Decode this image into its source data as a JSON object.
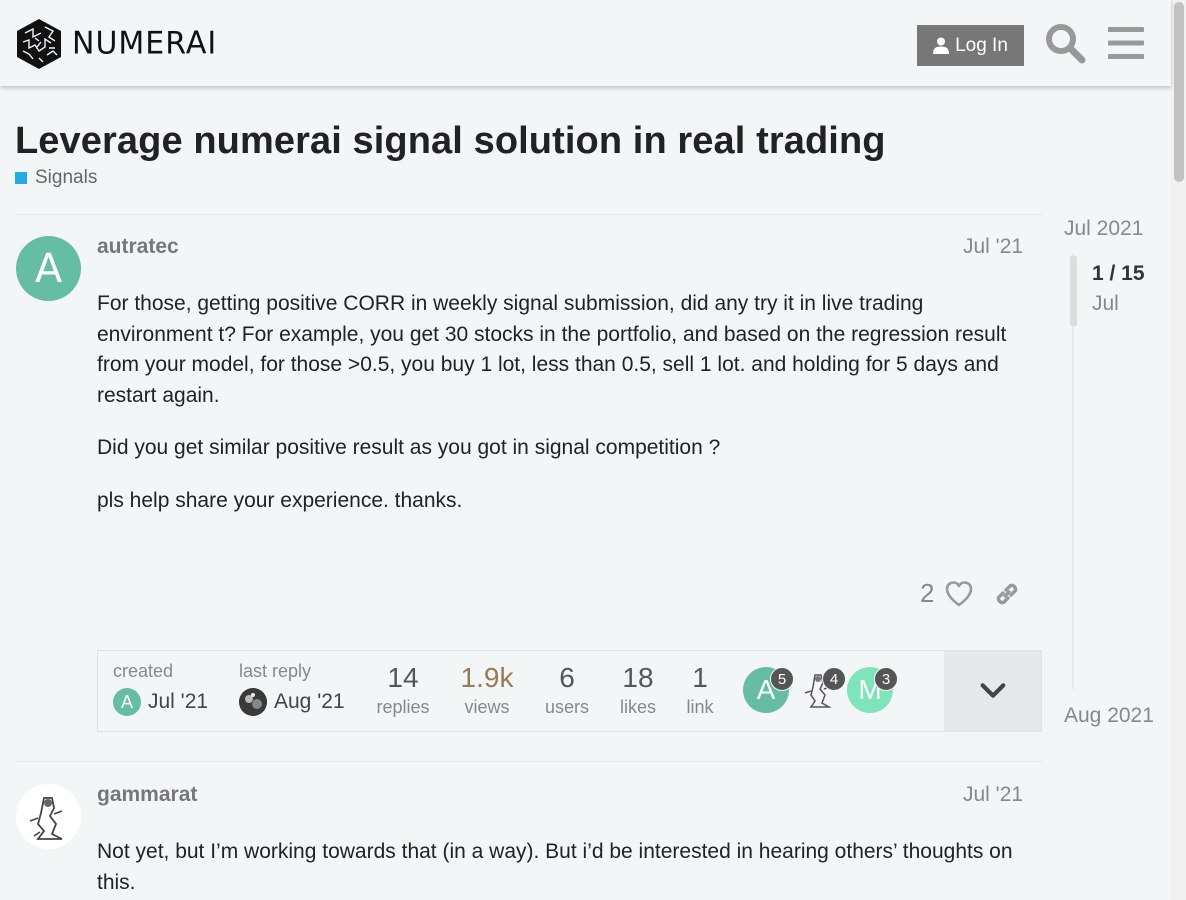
{
  "header": {
    "brand": "NUMERAI",
    "login_label": "Log In"
  },
  "topic": {
    "title": "Leverage numerai signal solution in real trading",
    "category": "Signals",
    "category_color": "#25aae1"
  },
  "posts": [
    {
      "username": "autratec",
      "avatar_letter": "A",
      "date": "Jul '21",
      "paragraphs": [
        "For those, getting positive CORR in weekly signal submission, did any try it in live trading environment t? For example, you get 30 stocks in the portfolio, and based on the regression result from your model, for those >0.5, you buy 1 lot, less than 0.5, sell 1 lot. and holding for 5 days and restart again.",
        "Did you get similar positive result as you got in signal competition ?",
        "pls help share your experience. thanks."
      ],
      "likes": "2"
    },
    {
      "username": "gammarat",
      "date": "Jul '21",
      "paragraphs": [
        "Not yet, but I’m working towards that (in a way). But i’d be interested in hearing others’ thoughts on this."
      ]
    }
  ],
  "summary": {
    "created_label": "created",
    "created_date": "Jul '21",
    "last_reply_label": "last reply",
    "last_reply_date": "Aug '21",
    "stats": [
      {
        "value": "14",
        "label": "replies"
      },
      {
        "value": "1.9k",
        "label": "views"
      },
      {
        "value": "6",
        "label": "users"
      },
      {
        "value": "18",
        "label": "likes"
      },
      {
        "value": "1",
        "label": "link"
      }
    ],
    "participants": [
      {
        "letter": "A",
        "count": "5"
      },
      {
        "letter": "",
        "count": "4"
      },
      {
        "letter": "M",
        "count": "3"
      }
    ]
  },
  "timeline": {
    "start": "Jul 2021",
    "position": "1 / 15",
    "month": "Jul",
    "end": "Aug 2021"
  },
  "colors": {
    "avatar_a": "#65bea1",
    "avatar_m": "#7fe3bb",
    "views": "#9b7a53"
  }
}
